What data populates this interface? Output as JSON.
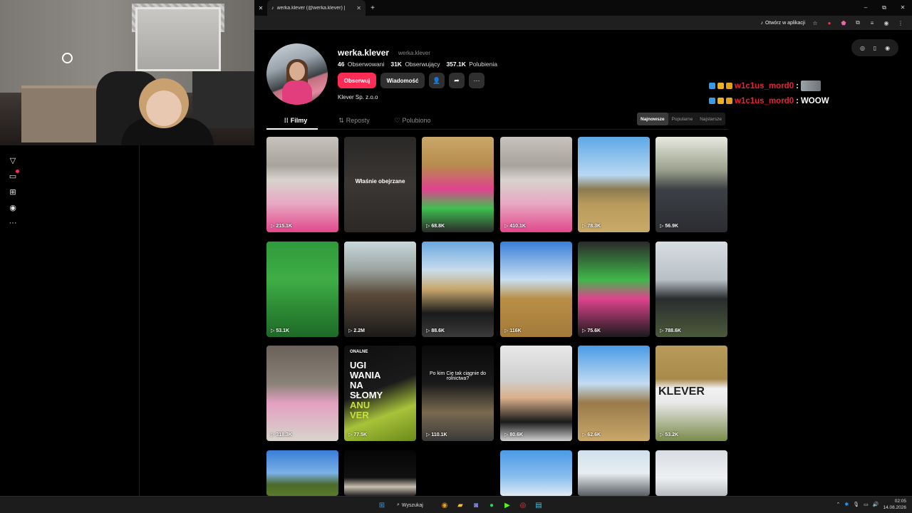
{
  "browser": {
    "tab_title": "werka.klever (@werka.klever) |",
    "open_in_app": "Otwórz w aplikacji"
  },
  "profile": {
    "username": "werka.klever",
    "nickname": "werka.klever",
    "following_count": "46",
    "following_label": "Obserwowani",
    "followers_count": "31K",
    "followers_label": "Obserwujący",
    "likes_count": "357.1K",
    "likes_label": "Polubienia",
    "follow_button": "Obserwuj",
    "message_button": "Wiadomość",
    "bio": "Klever Sp. z.o.o"
  },
  "tabs": [
    {
      "label": "Filmy",
      "icon": "grid-icon"
    },
    {
      "label": "Reposty",
      "icon": "repost-icon"
    },
    {
      "label": "Polubiono",
      "icon": "liked-icon"
    }
  ],
  "sort": [
    "Najnowsze",
    "Popularne",
    "Najstarsze"
  ],
  "videos": [
    {
      "views": "215.1K",
      "bg": "linear-gradient(180deg,#c7c3bd 0%,#a8a39b 30%,#d7d3ce 45%,#e7a8c2 70%,#e2488c 100%)"
    },
    {
      "views": "",
      "overlay": "Właśnie obejrzane",
      "bg": "linear-gradient(180deg,#2a2826 0%,#3a3735 50%,#2b2826 100%)"
    },
    {
      "views": "68.8K",
      "bg": "linear-gradient(180deg,#c9a86a 0%,#b88b4e 30%,#e0428f 55%,#3fbf4f 75%,#2a2a2a 100%)"
    },
    {
      "views": "410.1K",
      "bg": "linear-gradient(180deg,#c7c3bd 0%,#a8a39b 30%,#d7d3ce 45%,#e7a8c2 70%,#e2488c 100%)"
    },
    {
      "views": "78.3K",
      "bg": "linear-gradient(180deg,#5ea8e6 0%,#b8d8f2 40%,#8a7a50 55%,#b89a5a 70%,#c9aa6a 100%)"
    },
    {
      "views": "56.9K",
      "bg": "linear-gradient(180deg,#e8eadf 0%,#9aa08c 35%,#3d4046 55%,#2a2c30 100%)"
    },
    {
      "views": "53.1K",
      "bg": "linear-gradient(180deg,#2f9a3a 0%,#3fae46 40%,#2c8a34 70%,#1e6a28 100%)"
    },
    {
      "views": "2.2M",
      "bg": "linear-gradient(180deg,#c9d8dc 0%,#9aa4a0 30%,#5a4a3a 55%,#1a1a1a 100%)"
    },
    {
      "views": "88.6K",
      "bg": "linear-gradient(180deg,#6aa8e0 0%,#c8dcec 30%,#c8a76c 50%,#1a1a1a 75%,#3a3a3a 100%)"
    },
    {
      "views": "116K",
      "bg": "linear-gradient(180deg,#3a7ed8 0%,#c8dff2 40%,#b98e46 60%,#a47a3a 100%)"
    },
    {
      "views": "75.6K",
      "bg": "linear-gradient(180deg,#2a2a2a 0%,#3fb84a 40%,#e0428f 60%,#1a1a1a 100%)"
    },
    {
      "views": "788.6K",
      "bg": "linear-gradient(180deg,#d8dde2 0%,#b8c0c6 40%,#2a2c2e 60%,#4a5a3a 100%)"
    },
    {
      "views": "318.3K",
      "bg": "linear-gradient(180deg,#6a6258 0%,#8a8278 40%,#e2a0c0 60%,#d8d4cc 100%)"
    },
    {
      "views": "77.5K",
      "overlay_lines": [
        "ONALNE",
        "UGI",
        "WANIA",
        "NA",
        "SŁOMY",
        "ANU",
        "VER"
      ],
      "bg": "linear-gradient(160deg,#0e0e0e 0%,#1a1a1a 45%,#a8c23a 70%,#6a8a1a 100%)"
    },
    {
      "views": "110.1K",
      "overlay": "Po kim Cię tak ciągnie do rolnictwa?",
      "bg": "linear-gradient(180deg,#0a0a0a 0%,#1a1a1a 40%,#7a6a50 70%,#3a3a3a 100%)"
    },
    {
      "views": "80.6K",
      "bg": "linear-gradient(180deg,#e8e8e8 0%,#d0d0d0 35%,#d9b089 55%,#1a1a1a 80%,#d0d0d0 100%)"
    },
    {
      "views": "62.6K",
      "bg": "linear-gradient(180deg,#4a9ae6 0%,#c2dcf2 40%,#9a7a4a 60%,#c9a86a 100%)"
    },
    {
      "views": "53.2K",
      "overlay": "KLEVER",
      "bg": "linear-gradient(180deg,#b89a5a 0%,#a88a4a 35%,#f2f2f2 45%,#e8e8e8 60%,#7a8a4a 100%)"
    },
    {
      "views": "",
      "bg": "linear-gradient(180deg,#3a7ed8 0%,#7ab0e6 50%,#4a6a2a 75%,#5a7a2a 100%)"
    },
    {
      "views": "",
      "bg": "linear-gradient(180deg,#050505 0%,#111 60%,#c9c0b0 80%,#222 100%)"
    },
    {
      "views": "",
      "bg": "#000"
    },
    {
      "views": "",
      "bg": "linear-gradient(180deg,#4a9ae6 0%,#8cc0ee 60%,#dfeaf2 100%)"
    },
    {
      "views": "",
      "bg": "linear-gradient(180deg,#cfe0ee 0%,#e8eef2 50%,#5a5e62 100%)"
    },
    {
      "views": "",
      "bg": "linear-gradient(180deg,#d8dde2 0%,#eef0f2 60%,#b8bcc0 100%)"
    }
  ],
  "chat": [
    {
      "user": "w1c1us_mord0",
      "message": ""
    },
    {
      "user": "w1c1us_mord0",
      "message": "WOOW"
    }
  ],
  "taskbar": {
    "search": "Wyszukaj",
    "time": "02:05",
    "date": "14.08.2026"
  },
  "colors": {
    "accent": "#fe2c55",
    "chat_user": "#e0243a"
  }
}
